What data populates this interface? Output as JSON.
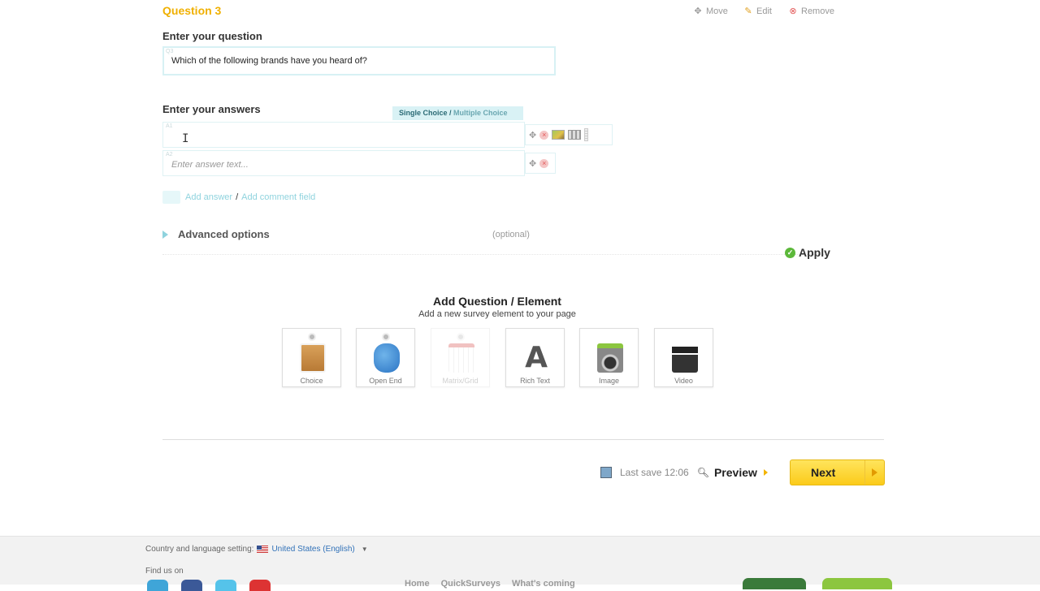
{
  "question": {
    "title": "Question 3",
    "actions": {
      "move": "Move",
      "edit": "Edit",
      "remove": "Remove"
    },
    "enter_question_label": "Enter your question",
    "question_tag": "Q3",
    "question_text": "Which of the following brands have you heard of?"
  },
  "answers": {
    "label": "Enter your answers",
    "mode_primary": "Single Choice /",
    "mode_secondary": "Multiple Choice",
    "rows": [
      {
        "tag": "A1",
        "value": ""
      },
      {
        "tag": "A2",
        "placeholder": "Enter answer text..."
      }
    ],
    "add_answer": "Add answer",
    "separator": "/",
    "add_comment": "Add comment field"
  },
  "advanced": {
    "label": "Advanced options",
    "optional": "(optional)"
  },
  "apply_label": "Apply",
  "add_element": {
    "title": "Add Question / Element",
    "subtitle": "Add a new survey element to your page",
    "tiles": [
      {
        "label": "Choice",
        "icon": "clipboard-checklist-icon"
      },
      {
        "label": "Open End",
        "icon": "chat-bubbles-icon"
      },
      {
        "label": "Matrix/Grid",
        "icon": "grid-calendar-icon"
      },
      {
        "label": "Rich Text",
        "icon": "letter-a-icon"
      },
      {
        "label": "Image",
        "icon": "camera-photo-icon"
      },
      {
        "label": "Video",
        "icon": "clapperboard-icon"
      }
    ]
  },
  "bottom_bar": {
    "last_save": "Last save 12:06",
    "preview": "Preview",
    "next": "Next"
  },
  "footer": {
    "country_label": "Country and language setting:",
    "country_value": "United States (English)",
    "find_us": "Find us on",
    "links": [
      "Home",
      "QuickSurveys",
      "What's coming"
    ]
  },
  "colors": {
    "accent_yellow": "#f0b000",
    "light_teal": "#d9f2f5",
    "link_blue": "#3272b8",
    "apply_green": "#5cb83a"
  }
}
